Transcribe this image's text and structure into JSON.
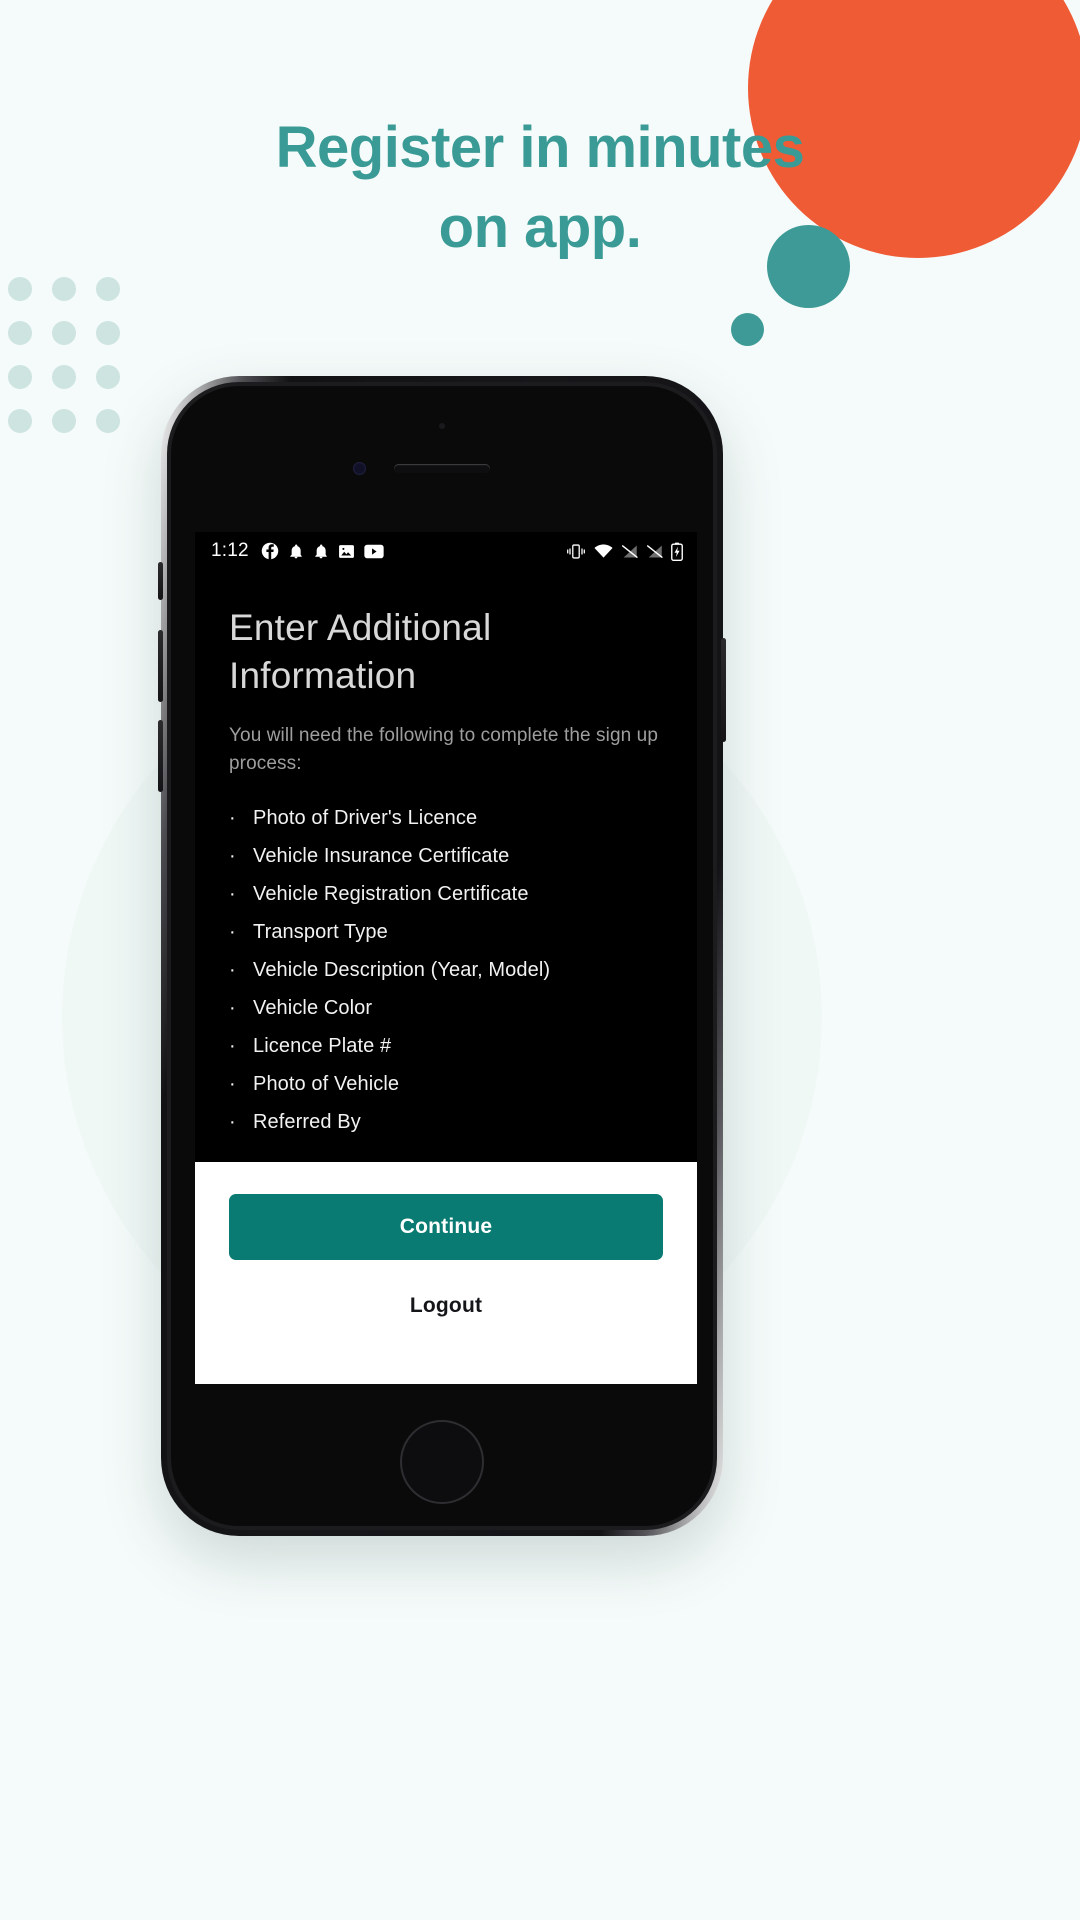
{
  "promo": {
    "headline_line1": "Register in minutes",
    "headline_line2": "on app.",
    "headline_color": "#3a9a95",
    "background_color": "#f5fbfa",
    "accent_orange": "#ef5b35",
    "accent_teal": "#3d9a96",
    "dot_color": "#cde4e0"
  },
  "phone": {
    "status_bar": {
      "time": "1:12",
      "left_icons": [
        "facebook-icon",
        "notification-bell-icon",
        "notification-bell-outline-icon",
        "image-icon",
        "youtube-icon"
      ],
      "right_icons": [
        "vibrate-icon",
        "wifi-icon",
        "no-signal-icon",
        "no-sim-signal-icon",
        "battery-charging-icon"
      ]
    },
    "screen": {
      "title": "Enter Additional Information",
      "subtitle": "You will need the following to complete the sign up process:",
      "bullet_glyph": "·",
      "requirements": [
        "Photo of Driver's Licence",
        "Vehicle Insurance Certificate",
        "Vehicle Registration Certificate",
        "Transport Type",
        "Vehicle Description (Year, Model)",
        "Vehicle Color",
        "Licence Plate #",
        "Photo of Vehicle",
        "Referred By"
      ],
      "primary_button": "Continue",
      "secondary_button": "Logout",
      "primary_button_color": "#0a7b72",
      "screen_background": "#000000"
    }
  }
}
